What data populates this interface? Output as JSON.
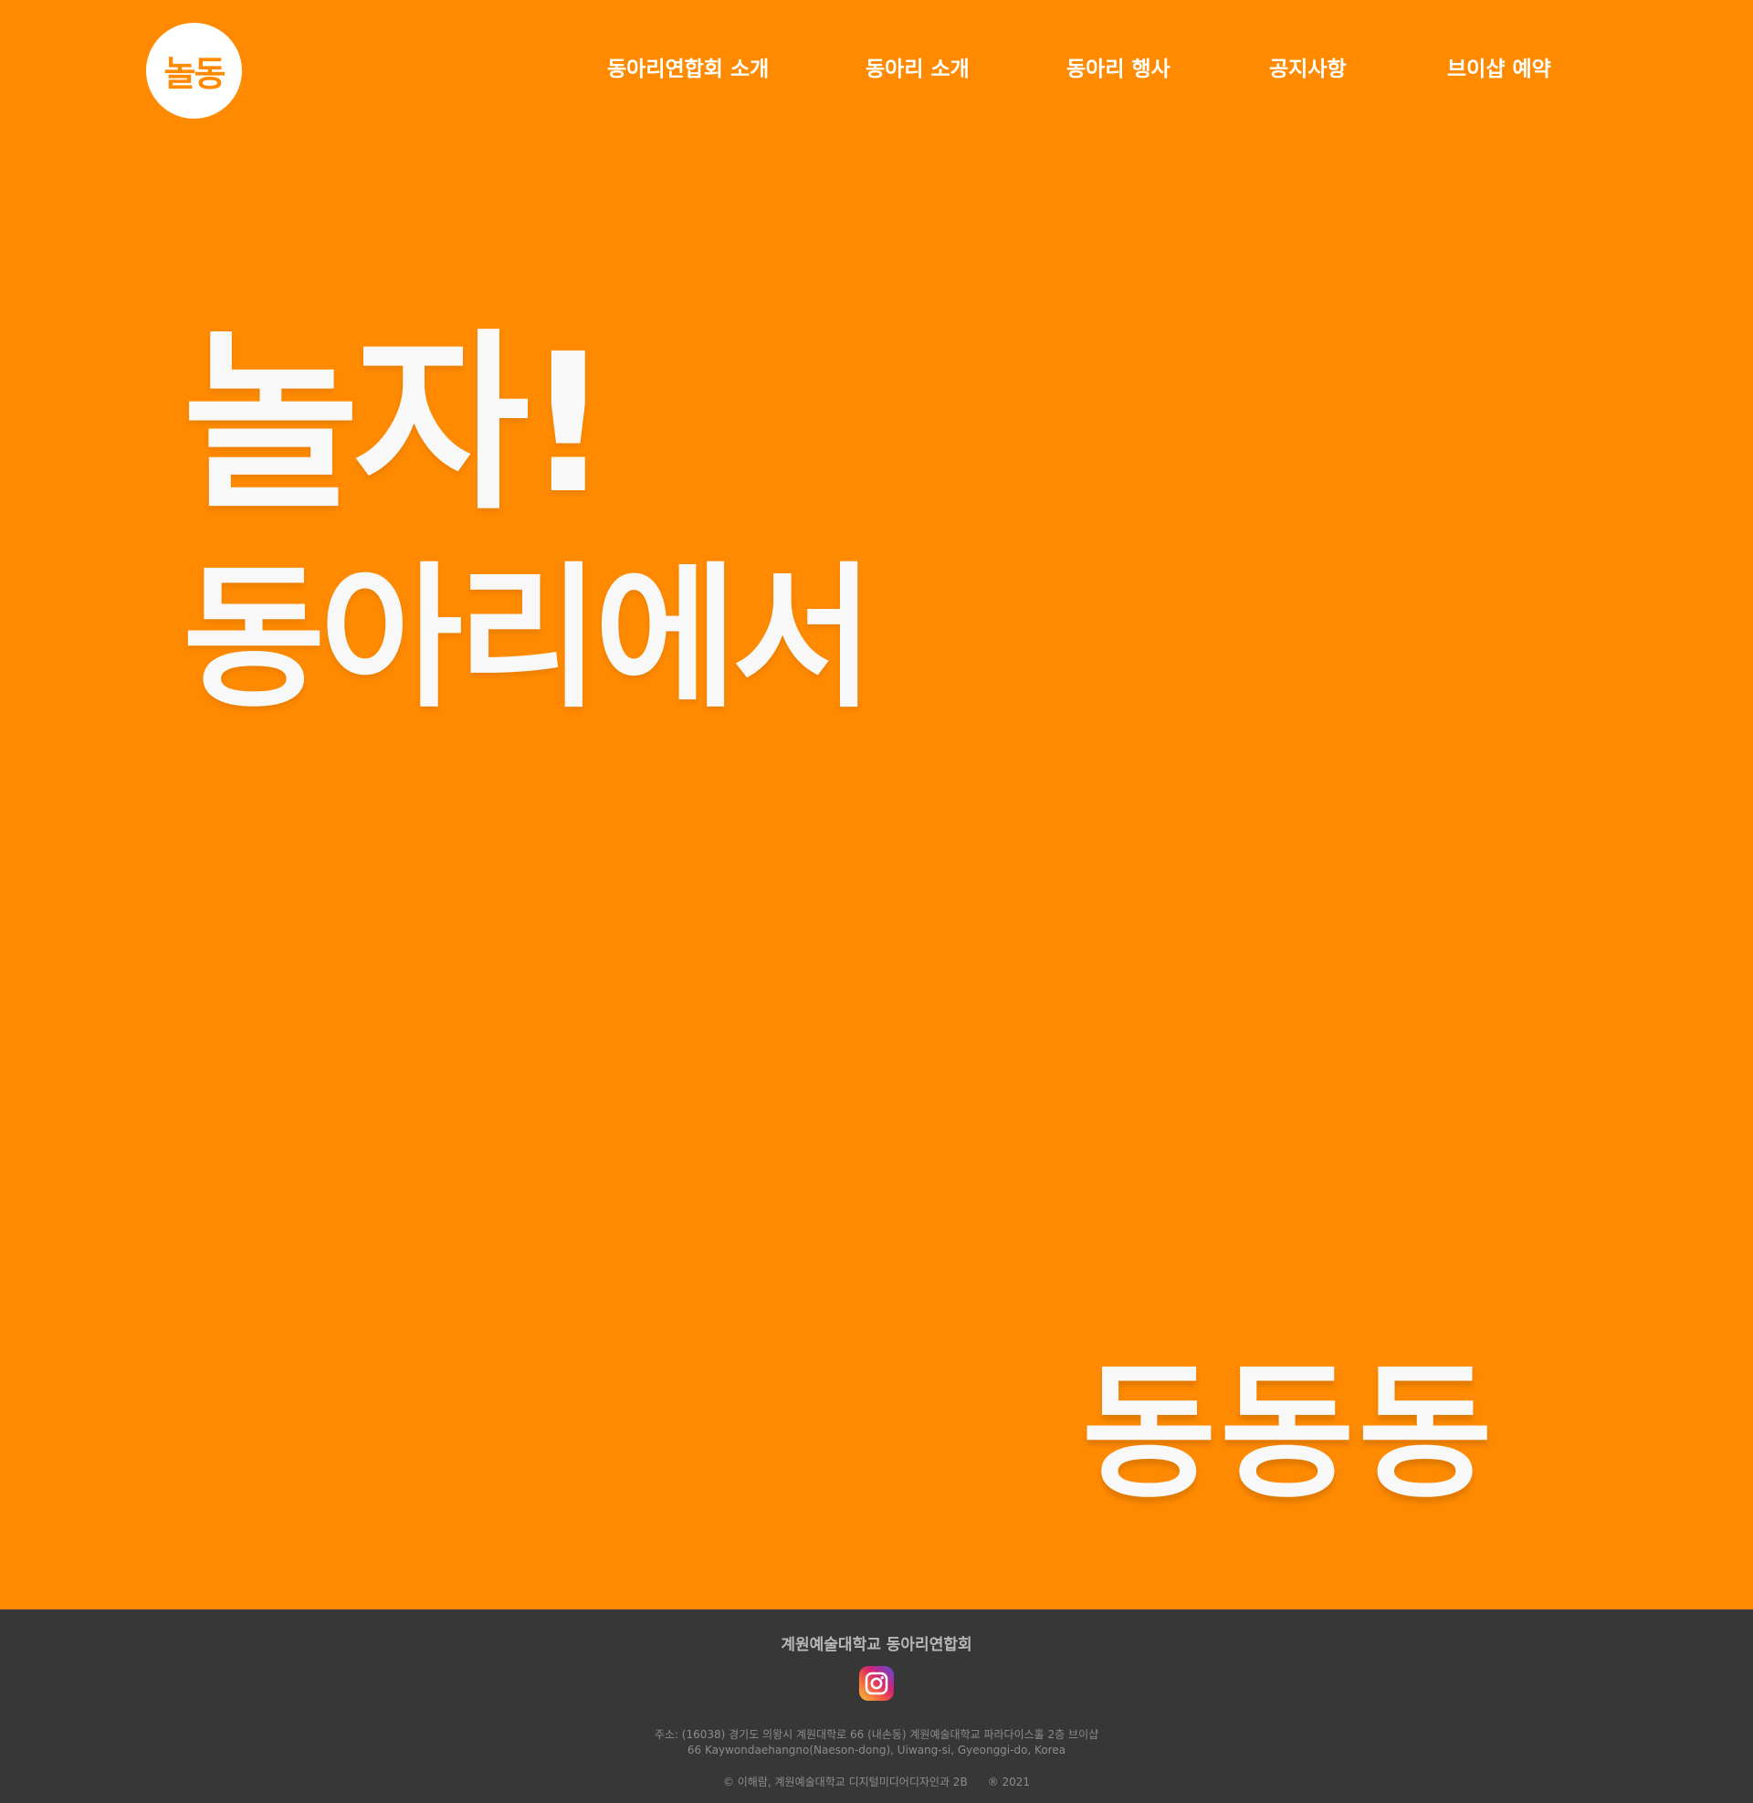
{
  "header": {
    "logo_text": "놀동",
    "nav": [
      {
        "label": "동아리연합회 소개"
      },
      {
        "label": "동아리 소개"
      },
      {
        "label": "동아리 행사"
      },
      {
        "label": "공지사항"
      },
      {
        "label": "브이샵 예약"
      }
    ]
  },
  "hero": {
    "line1": "놀자!",
    "line2": "동아리에서",
    "line3": "동동동"
  },
  "footer": {
    "title": "계원예술대학교 동아리연합회",
    "instagram_icon": "instagram-icon",
    "address_kr": "주소: (16038) 경기도 의왕시 계원대학로 66 (내손동) 계원예술대학교 파라다이스홀 2층 브이샵",
    "address_en": "66 Kaywondaehangno(Naeson-dong), Uiwang-si, Gyeonggi-do, Korea",
    "credit": "© 이해람, 계원예술대학교 디지털미디어디자인과 2B",
    "year": "® 2021"
  },
  "colors": {
    "background": "#ff8a00",
    "footer_bg": "#373737",
    "text_light": "#f8f8f8"
  }
}
